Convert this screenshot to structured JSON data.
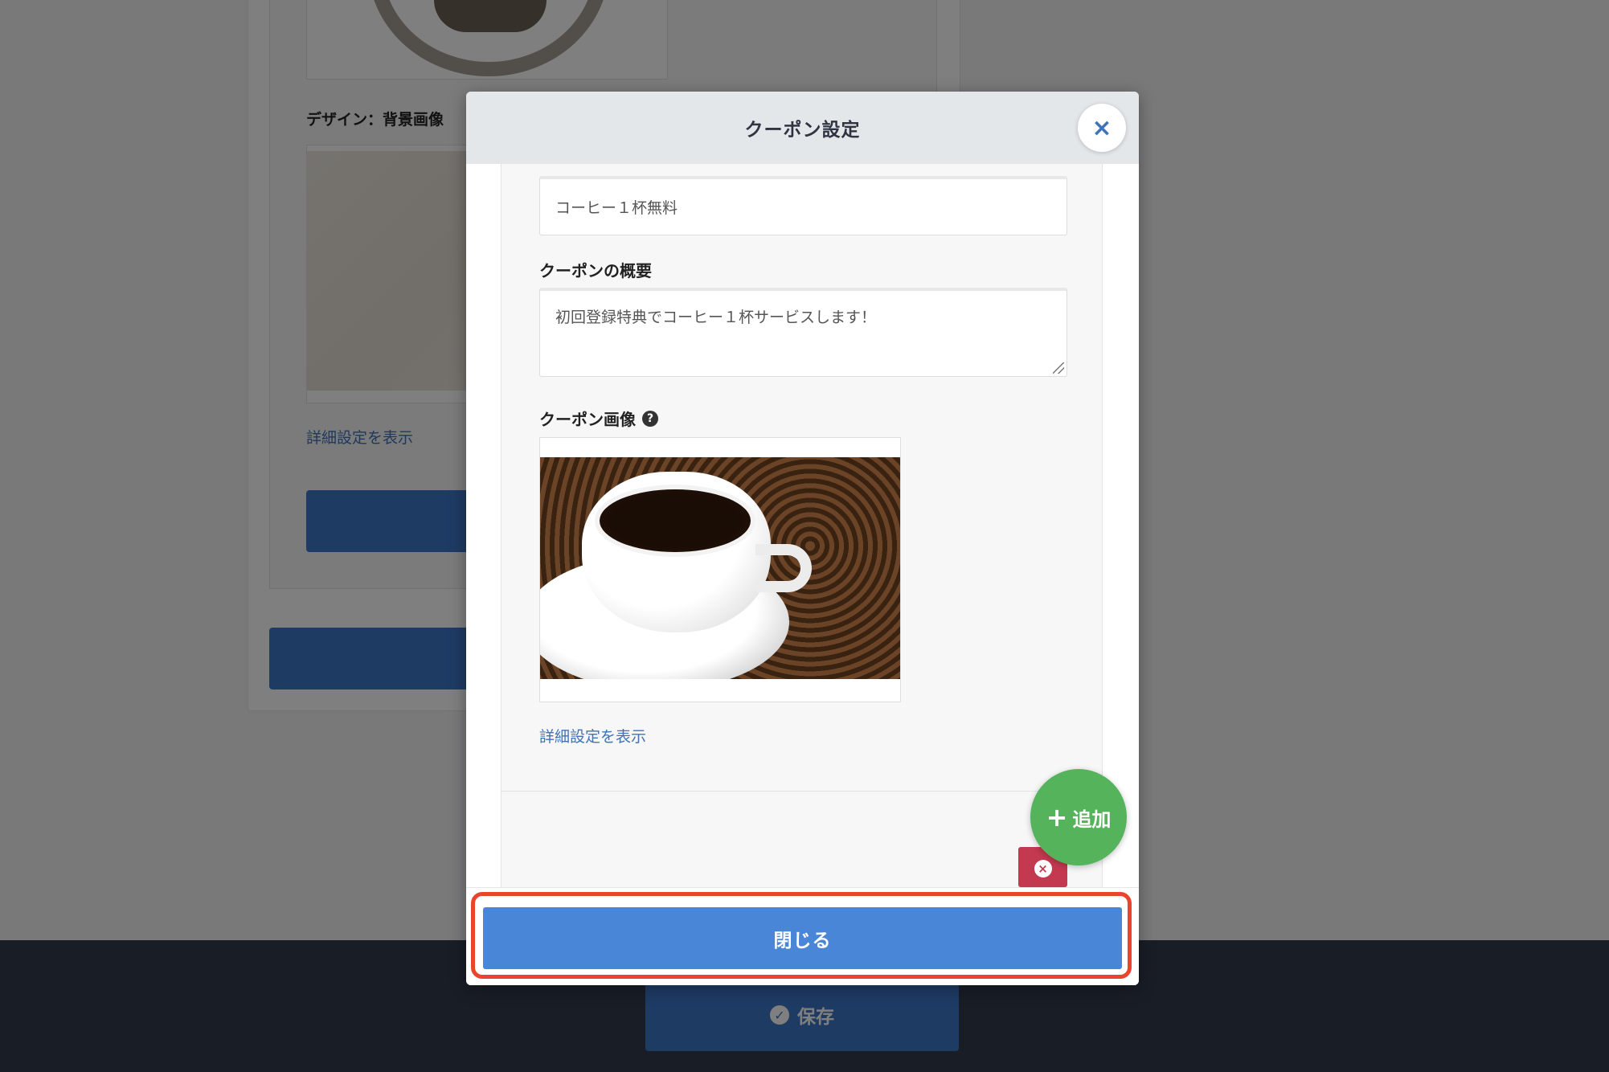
{
  "background": {
    "design_bg_label": "デザイン：背景画像",
    "detail_link": "詳細設定を表示",
    "save_label": "保存"
  },
  "modal": {
    "title": "クーポン設定",
    "close_x": "×",
    "coupon_name_value": "コーヒー１杯無料",
    "summary_label": "クーポンの概要",
    "summary_value": "初回登録特典でコーヒー１杯サービスします！",
    "image_label": "クーポン画像",
    "help_icon": "?",
    "detail_link": "詳細設定を表示",
    "add_label": "追加",
    "close_button": "閉じる"
  },
  "colors": {
    "primary": "#4a86d8",
    "add_green": "#55b35b",
    "delete_red": "#c3394f",
    "highlight": "#e8442e",
    "footer_dark": "#323a4c"
  },
  "icons": {
    "close": "close-icon",
    "help": "question-circle-icon",
    "add": "plus-icon",
    "delete": "times-circle-icon",
    "save": "check-circle-icon"
  }
}
